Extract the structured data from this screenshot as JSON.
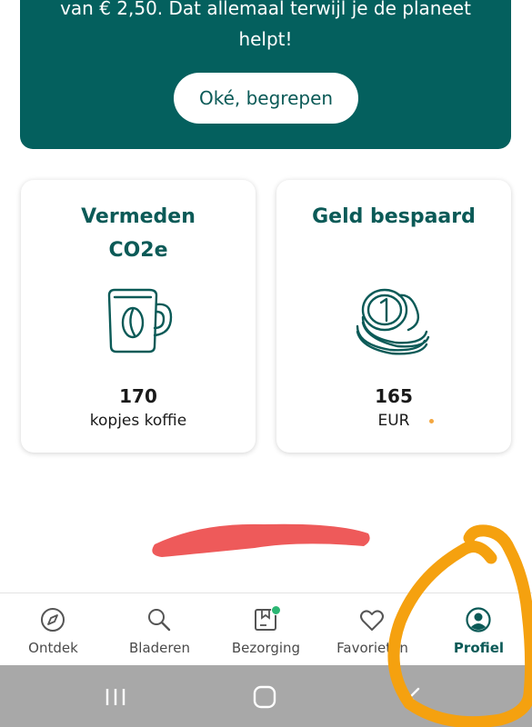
{
  "banner": {
    "text": "van € 2,50. Dat allemaal terwijl je de planeet helpt!",
    "button_label": "Oké, begrepen"
  },
  "cards": [
    {
      "title": "Vermeden CO2e",
      "icon": "coffee-mug-icon",
      "value": "170",
      "unit": "kopjes koffie"
    },
    {
      "title": "Geld bespaard",
      "icon": "coins-icon",
      "value": "165",
      "unit": "EUR"
    }
  ],
  "nav": {
    "items": [
      {
        "label": "Ontdek",
        "icon": "compass-icon"
      },
      {
        "label": "Bladeren",
        "icon": "search-icon"
      },
      {
        "label": "Bezorging",
        "icon": "delivery-box-icon"
      },
      {
        "label": "Favorieten",
        "icon": "heart-icon"
      },
      {
        "label": "Profiel",
        "icon": "profile-icon"
      }
    ],
    "active": "Profiel"
  },
  "colors": {
    "brand": "#04605e",
    "text_brand": "#0b5a57",
    "badge": "#2bb673",
    "annotation_orange": "#f5a10f",
    "annotation_red": "#ee5a5a"
  }
}
